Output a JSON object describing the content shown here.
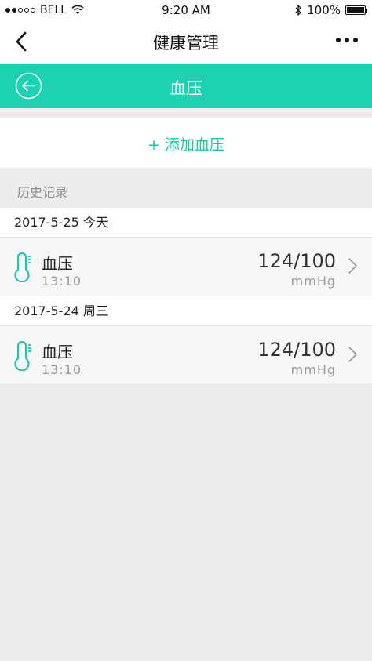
{
  "status_bar": {
    "carrier": "BELL",
    "time": "9:20 AM",
    "battery": "100%"
  },
  "nav": {
    "title": "健康管理"
  },
  "header": {
    "title": "血压"
  },
  "add_button": {
    "label": "+ 添加血压"
  },
  "history": {
    "label": "历史记录",
    "groups": [
      {
        "date": "2017-5-25 今天",
        "records": [
          {
            "name": "血压",
            "time": "13:10",
            "value": "124/100",
            "unit": "mmHg"
          }
        ]
      },
      {
        "date": "2017-5-24 周三",
        "records": [
          {
            "name": "血压",
            "time": "13:10",
            "value": "124/100",
            "unit": "mmHg"
          }
        ]
      }
    ]
  },
  "colors": {
    "accent": "#1dd2b0",
    "background": "#ececec"
  },
  "icons": {
    "back": "chevron-left-icon",
    "more": "more-dots-icon",
    "header_back": "circle-arrow-left-icon",
    "record": "thermometer-icon",
    "record_chevron": "chevron-right-icon"
  }
}
